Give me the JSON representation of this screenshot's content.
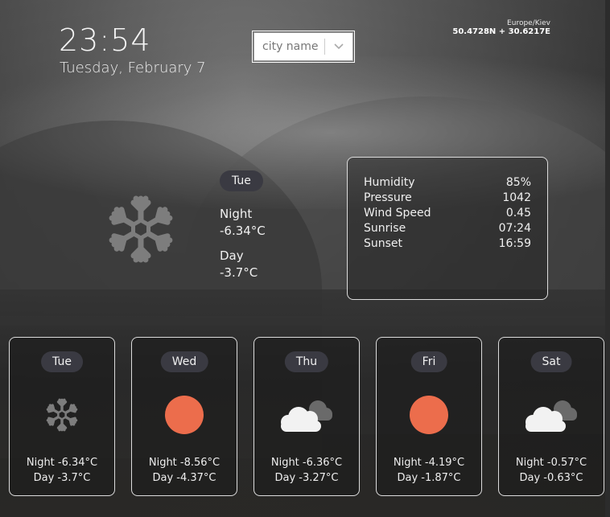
{
  "clock": {
    "time": "23:54",
    "date": "Tuesday, February 7"
  },
  "city_select": {
    "placeholder": "city name"
  },
  "location": {
    "timezone": "Europe/Kiev",
    "coords": "50.4728N + 30.6217E"
  },
  "today": {
    "day": "Tue",
    "icon": "snowflake-icon",
    "night_label": "Night",
    "night_temp": "-6.34°C",
    "day_label": "Day",
    "day_temp": "-3.7°C"
  },
  "details": [
    {
      "label": "Humidity",
      "value": "85%"
    },
    {
      "label": "Pressure",
      "value": "1042"
    },
    {
      "label": "Wind Speed",
      "value": "0.45"
    },
    {
      "label": "Sunrise",
      "value": "07:24"
    },
    {
      "label": "Sunset",
      "value": "16:59"
    }
  ],
  "forecast": [
    {
      "day": "Tue",
      "icon": "snowflake-icon",
      "night": "Night -6.34°C",
      "dayt": "Day -3.7°C"
    },
    {
      "day": "Wed",
      "icon": "sun-icon",
      "night": "Night -8.56°C",
      "dayt": "Day -4.37°C"
    },
    {
      "day": "Thu",
      "icon": "cloud-icon",
      "night": "Night -6.36°C",
      "dayt": "Day -3.27°C"
    },
    {
      "day": "Fri",
      "icon": "sun-icon",
      "night": "Night -4.19°C",
      "dayt": "Day -1.87°C"
    },
    {
      "day": "Sat",
      "icon": "cloud-icon",
      "night": "Night -0.57°C",
      "dayt": "Day -0.63°C"
    }
  ],
  "colors": {
    "sun": "#ec6d4c",
    "cloud_front": "#f2f2f2",
    "cloud_back": "#6a6a6a",
    "snow": "#7d7d7d",
    "pill_bg": "#3a3a42"
  }
}
